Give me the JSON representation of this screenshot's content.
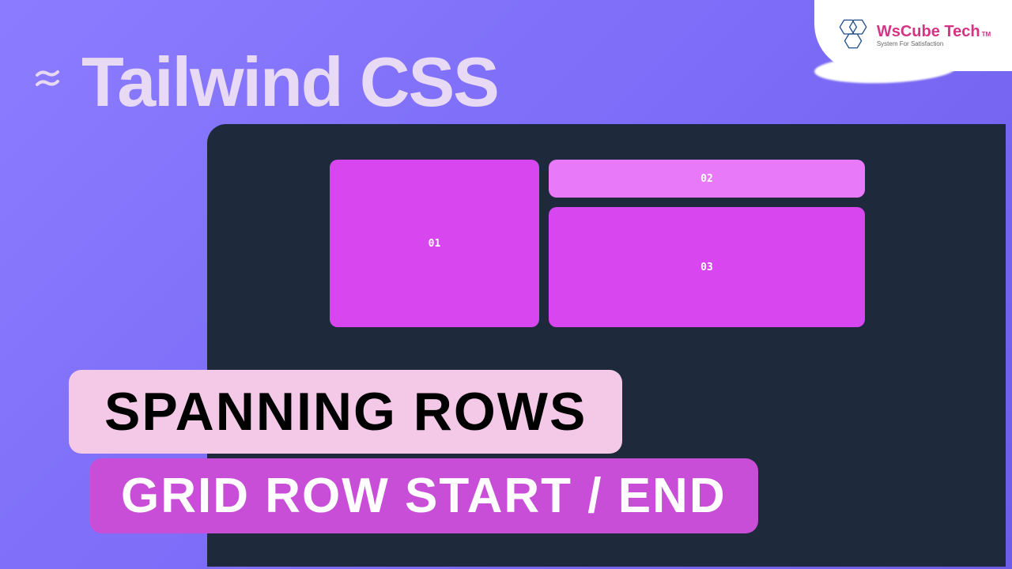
{
  "header": {
    "title": "Tailwind CSS"
  },
  "brand": {
    "name_part1": "WsCube",
    "name_part2": "Tech",
    "tagline": "System For Satisfaction",
    "tm": "TM"
  },
  "grid": {
    "cell_01": "01",
    "cell_02": "02",
    "cell_03": "03"
  },
  "banners": {
    "line1": "SPANNING ROWS",
    "line2": "GRID ROW START / END"
  },
  "colors": {
    "bg_gradient_start": "#8b7cff",
    "bg_gradient_end": "#6d5ce8",
    "browser_bg": "#1e293b",
    "cell_dark": "#d846ef",
    "cell_light": "#e879f9",
    "banner1_bg": "#f4c9e8",
    "banner2_bg": "#c84ed8"
  }
}
